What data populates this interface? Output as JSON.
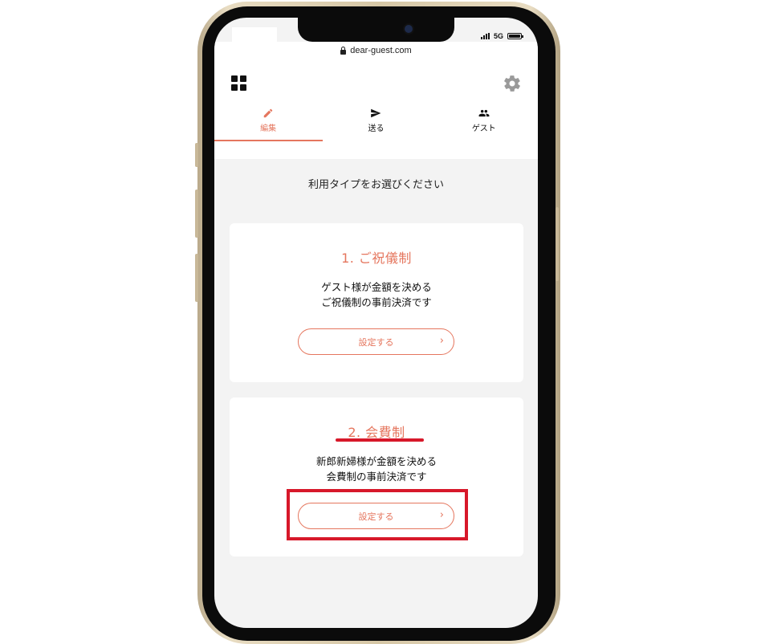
{
  "browser": {
    "url": "dear-guest.com",
    "network": "5G"
  },
  "tabs": [
    {
      "label": "編集",
      "icon": "pencil-icon",
      "active": true
    },
    {
      "label": "送る",
      "icon": "send-icon",
      "active": false
    },
    {
      "label": "ゲスト",
      "icon": "people-icon",
      "active": false
    }
  ],
  "main": {
    "prompt": "利用タイプをお選びください",
    "cards": [
      {
        "title": "1. ご祝儀制",
        "desc_line1": "ゲスト様が金額を決める",
        "desc_line2": "ご祝儀制の事前決済です",
        "button": "設定する"
      },
      {
        "title": "2. 会費制",
        "desc_line1": "新郎新婦様が金額を決める",
        "desc_line2": "会費制の事前決済です",
        "button": "設定する"
      }
    ]
  },
  "colors": {
    "accent": "#e5765e",
    "highlight": "#d7182a",
    "background": "#f3f3f3"
  }
}
